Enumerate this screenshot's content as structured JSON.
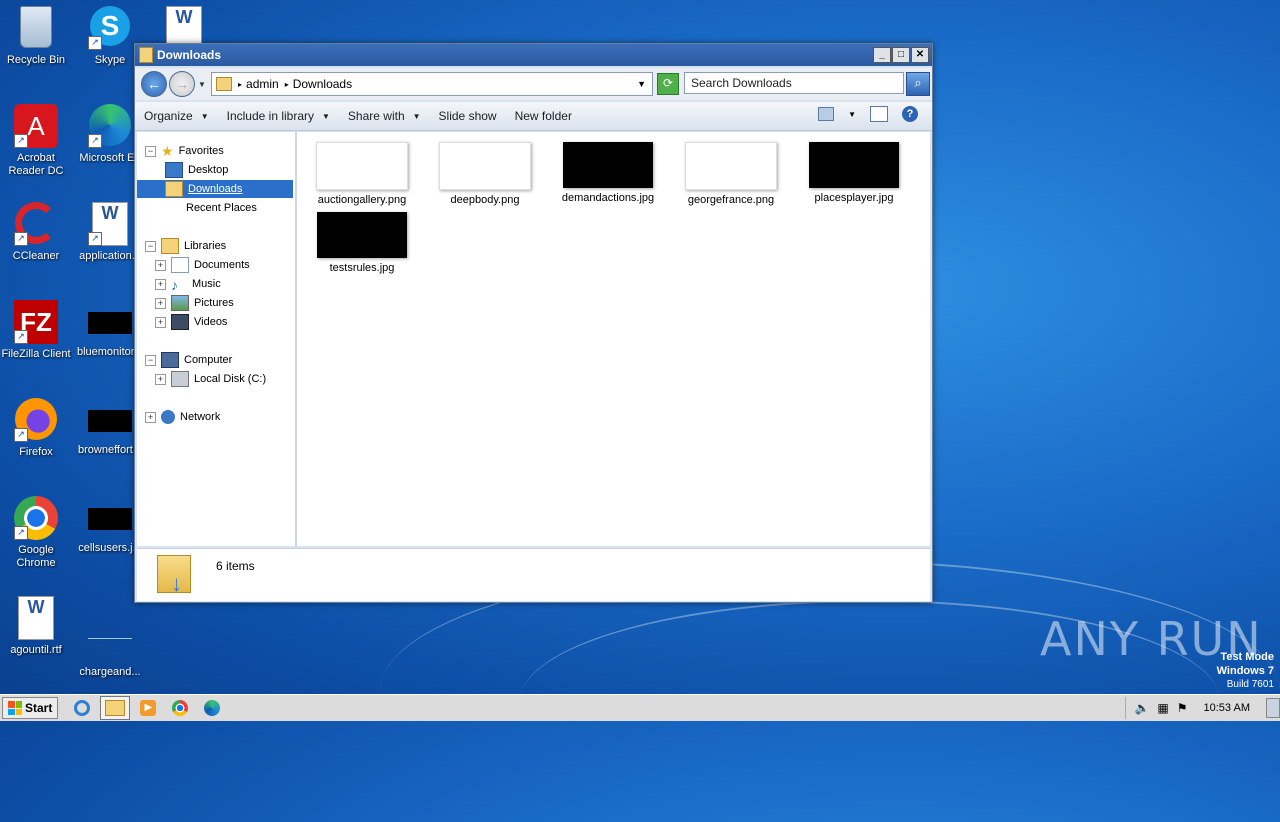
{
  "desktop": {
    "icons": [
      {
        "label": "Recycle Bin"
      },
      {
        "label": "Skype"
      },
      {
        "label": "Acrobat Reader DC"
      },
      {
        "label": "Microsoft Ed"
      },
      {
        "label": "CCleaner"
      },
      {
        "label": "application..."
      },
      {
        "label": "FileZilla Client"
      },
      {
        "label": "bluemonitor..."
      },
      {
        "label": "Firefox"
      },
      {
        "label": "browneffort..."
      },
      {
        "label": "Google Chrome"
      },
      {
        "label": "cellsusers.j..."
      },
      {
        "label": "agountil.rtf"
      },
      {
        "label": "chargeand..."
      }
    ]
  },
  "window": {
    "title": "Downloads",
    "buttons": {
      "minimize": "_",
      "maximize": "□",
      "close": "✕"
    },
    "address": {
      "crumbs": [
        "admin",
        "Downloads"
      ]
    },
    "search": {
      "placeholder": "Search Downloads"
    },
    "toolbar": {
      "organize": "Organize",
      "include": "Include in library",
      "share": "Share with",
      "slideshow": "Slide show",
      "newfolder": "New folder",
      "help": "?"
    },
    "nav": {
      "favorites": "Favorites",
      "desktop": "Desktop",
      "downloads": "Downloads",
      "recent": "Recent Places",
      "libraries": "Libraries",
      "documents": "Documents",
      "music": "Music",
      "pictures": "Pictures",
      "videos": "Videos",
      "computer": "Computer",
      "localdisk": "Local Disk (C:)",
      "network": "Network"
    },
    "files": [
      {
        "name": "auctiongallery.png",
        "thumb": "white"
      },
      {
        "name": "deepbody.png",
        "thumb": "white"
      },
      {
        "name": "demandactions.jpg",
        "thumb": "black"
      },
      {
        "name": "georgefrance.png",
        "thumb": "white"
      },
      {
        "name": "placesplayer.jpg",
        "thumb": "black"
      },
      {
        "name": "testsrules.jpg",
        "thumb": "black"
      }
    ],
    "status": {
      "count": "6 items"
    }
  },
  "taskbar": {
    "start": "Start",
    "clock": "10:53 AM"
  },
  "watermark": {
    "line1": "Test Mode",
    "line2": "Windows 7",
    "line3": "Build 7601",
    "brand": "ANY RUN"
  }
}
